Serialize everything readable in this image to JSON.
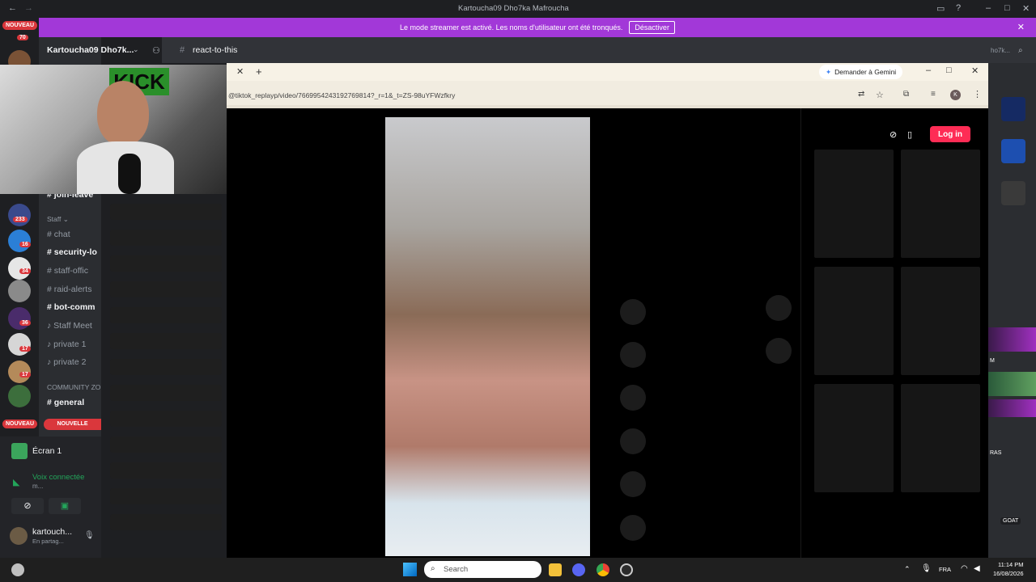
{
  "window": {
    "title": "Kartoucha09 Dho7ka Mafroucha"
  },
  "banner": {
    "text": "Le mode streamer est activé. Les noms d'utilisateur ont été tronqués.",
    "button": "Désactiver"
  },
  "nouveau": "NOUVEAU",
  "nouvelle": "NOUVELLE",
  "badges": [
    "70",
    "233",
    "16",
    "34",
    "36",
    "17",
    "17"
  ],
  "server": {
    "name": "Kartoucha09 Dho7k..."
  },
  "topbar": {
    "channel": "react-to-this",
    "right_text": "ho7k..."
  },
  "channels": [
    {
      "label": "join-leave",
      "bold": true
    },
    {
      "label": "Staff",
      "category": true
    },
    {
      "label": "chat",
      "bold": false
    },
    {
      "label": "security-lo",
      "bold": true
    },
    {
      "label": "staff-offic",
      "bold": false
    },
    {
      "label": "raid-alerts",
      "bold": false
    },
    {
      "label": "bot-comm",
      "bold": true
    },
    {
      "label": "Staff Meet",
      "bold": false
    },
    {
      "label": "private 1",
      "bold": false
    },
    {
      "label": "private 2",
      "bold": false
    },
    {
      "label": "COMMUNITY ZO",
      "category": true
    },
    {
      "label": "general",
      "bold": true
    }
  ],
  "screen": {
    "label": "Écran 1",
    "voice": "Voix connectée",
    "voice_sub": "m..."
  },
  "user": {
    "name": "kartouch...",
    "status": "En partag..."
  },
  "browser": {
    "gemini": "Demander à Gemini",
    "url": "@tiktok_replayp/video/7669954243192769814?_r=1&_t=ZS-98uYFWzfkry",
    "profile": "K"
  },
  "tiktok": {
    "login": "Log in"
  },
  "webcam": {
    "sign": "KICK"
  },
  "right_labels": [
    "M",
    "RAS",
    "GOAT"
  ],
  "taskbar": {
    "search_placeholder": "Search",
    "lang": "FRA",
    "time": "11:14 PM",
    "date": "16/08/2026"
  }
}
